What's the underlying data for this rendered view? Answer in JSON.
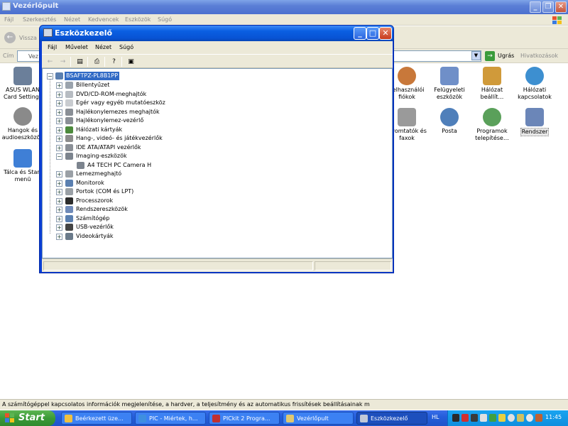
{
  "bg_window": {
    "title": "Vezérlőpult",
    "menu": [
      "Fájl",
      "Szerkesztés",
      "Nézet",
      "Kedvencek",
      "Eszközök",
      "Súgó"
    ],
    "back_label": "Vissza",
    "address_label": "Cím",
    "address_value": "Vez",
    "go_label": "Ugrás",
    "links_label": "Hivatkozások",
    "items_left": [
      {
        "label": "ASUS WLAN Card Settings",
        "icon": "wlan-card-icon",
        "color": "#6b7f9a"
      },
      {
        "label": "Hangok és audioeszközök",
        "icon": "speaker-icon",
        "color": "#8a8a8a"
      },
      {
        "label": "Tálca és Start menü",
        "icon": "taskbar-icon",
        "color": "#3f7fd6"
      }
    ],
    "items_right": [
      {
        "label": "Felhasználói fiókok",
        "icon": "users-icon",
        "color": "#c8783a"
      },
      {
        "label": "Felügyeleti eszközök",
        "icon": "admin-tools-icon",
        "color": "#6f8fc8"
      },
      {
        "label": "Hálózat beállít…",
        "icon": "network-setup-icon",
        "color": "#d09a3a"
      },
      {
        "label": "Hálózati kapcsolatok",
        "icon": "network-connections-icon",
        "color": "#3d8fd0"
      },
      {
        "label": "Nyomtatók és faxok",
        "icon": "printer-icon",
        "color": "#9a9a9a"
      },
      {
        "label": "Posta",
        "icon": "mail-icon",
        "color": "#4f7fba"
      },
      {
        "label": "Programok telepítése…",
        "icon": "add-remove-icon",
        "color": "#5aa05a"
      },
      {
        "label": "Rendszer",
        "icon": "system-icon",
        "color": "#6b86b8"
      }
    ],
    "status_text": "A számítógéppel kapcsolatos információk megjelenítése, a hardver, a teljesítmény és az automatikus frissítések beállításainak m"
  },
  "device_manager": {
    "title": "Eszközkezelő",
    "menu": [
      "Fájl",
      "Művelet",
      "Nézet",
      "Súgó"
    ],
    "root": "BSAFTPZ-PL8B1PP",
    "categories": [
      {
        "label": "Billentyűzet",
        "icon": "keyboard-icon",
        "color": "#9aa3ad"
      },
      {
        "label": "DVD/CD-ROM-meghajtók",
        "icon": "cdrom-icon",
        "color": "#b7bcc2"
      },
      {
        "label": "Egér vagy egyéb mutatóeszköz",
        "icon": "mouse-icon",
        "color": "#c9ccd0"
      },
      {
        "label": "Hajlékonylemezes meghajtók",
        "icon": "floppy-drive-icon",
        "color": "#8a8f96"
      },
      {
        "label": "Hajlékonylemez-vezérlő",
        "icon": "floppy-controller-icon",
        "color": "#8a8f96"
      },
      {
        "label": "Hálózati kártyák",
        "icon": "network-card-icon",
        "color": "#4c8a3c"
      },
      {
        "label": "Hang-, videó- és játékvezérlők",
        "icon": "sound-icon",
        "color": "#8c8c8c"
      },
      {
        "label": "IDE ATA/ATAPI vezérlők",
        "icon": "ide-icon",
        "color": "#8a8f96"
      },
      {
        "label": "Imaging-eszközök",
        "icon": "camera-icon",
        "color": "#7c848e",
        "expanded": true,
        "child": "A4 TECH PC Camera H"
      },
      {
        "label": "Lemezmeghajtó",
        "icon": "disk-drive-icon",
        "color": "#9aa0a6"
      },
      {
        "label": "Monitorok",
        "icon": "monitor-icon",
        "color": "#5a7fb0"
      },
      {
        "label": "Portok (COM és LPT)",
        "icon": "port-icon",
        "color": "#9aa0a6"
      },
      {
        "label": "Processzorok",
        "icon": "processor-icon",
        "color": "#2c2c2c"
      },
      {
        "label": "Rendszereszközök",
        "icon": "system-devices-icon",
        "color": "#6f8ab8"
      },
      {
        "label": "Számítógép",
        "icon": "computer-icon",
        "color": "#5a7fb0"
      },
      {
        "label": "USB-vezérlők",
        "icon": "usb-icon",
        "color": "#444"
      },
      {
        "label": "Videokártyák",
        "icon": "video-card-icon",
        "color": "#6a7a8a"
      }
    ]
  },
  "taskbar": {
    "start_label": "Start",
    "buttons": [
      {
        "label": "Beérkezett üze...",
        "icon": "mail-icon",
        "color": "#f0c040"
      },
      {
        "label": "PIC - Miértek, h...",
        "icon": "browser-icon",
        "color": "#3e8fe0"
      },
      {
        "label": "PICkit 2 Progra...",
        "icon": "pickit-icon",
        "color": "#c03030"
      },
      {
        "label": "Vezérlőpult",
        "icon": "control-panel-icon",
        "color": "#e0c870"
      },
      {
        "label": "Eszközkezelő",
        "icon": "device-manager-icon",
        "color": "#c0c8d8"
      }
    ],
    "language": "HL",
    "clock": "11:45"
  },
  "colors": {
    "xp_title_blue": "#0a5fe2",
    "taskbar_blue": "#245edb",
    "start_green": "#3b9a37",
    "selection": "#316ac5"
  }
}
